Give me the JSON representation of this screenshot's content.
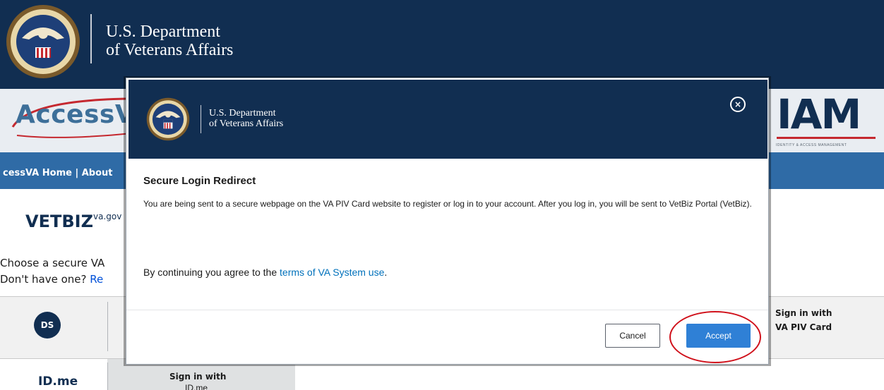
{
  "page": {
    "header_brand": {
      "line1": "U.S. Department",
      "line2": "of Veterans Affairs"
    },
    "banner": {
      "accessva_logo": "AccessVA",
      "iam_logo": "IAM",
      "iam_tagline": "IDENTITY & ACCESS MANAGEMENT"
    },
    "nav": {
      "text": "cessVA Home | About "
    },
    "vetbiz": {
      "logo": "VETBIZ",
      "suffix": "va.gov"
    },
    "choose": {
      "line1": "Choose a secure VA",
      "line2_prefix": "Don't have one? ",
      "line2_link": "Re"
    },
    "signin": {
      "ds_icon": "DS",
      "piv_label_1": "Sign in with",
      "piv_label_2": "VA PIV Card",
      "idme_logo": "ID.me",
      "idme_label_1": "Sign in with",
      "idme_label_2": "ID.me"
    }
  },
  "modal": {
    "brand": {
      "line1": "U.S. Department",
      "line2": "of Veterans Affairs"
    },
    "close_symbol": "×",
    "title": "Secure Login Redirect",
    "body": "You are being sent to a secure webpage on the VA PIV Card website to register or log in to your account. After you log in, you will be sent to VetBiz Portal (VetBiz).",
    "agree_prefix": "By continuing you agree to the ",
    "agree_link": "terms of VA System use",
    "agree_suffix": ".",
    "cancel_label": "Cancel",
    "accept_label": "Accept"
  },
  "colors": {
    "va_navy": "#112e51",
    "accent_blue": "#2f80d6",
    "highlight_red": "#d0101a"
  }
}
